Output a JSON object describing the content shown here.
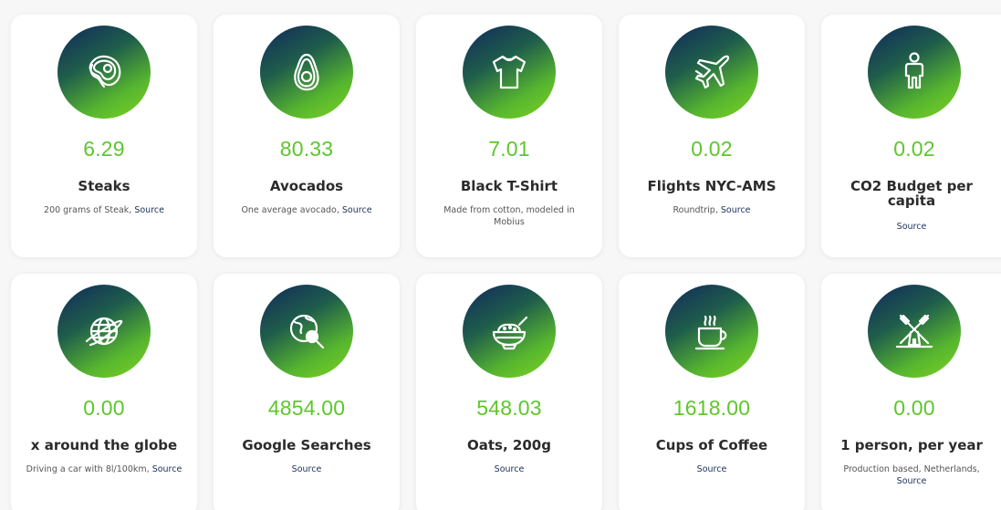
{
  "colors": {
    "accent_green": "#5ec62d",
    "icon_gradient_start": "#10285c",
    "icon_gradient_end": "#7ed321",
    "source_link": "#1c2f57"
  },
  "cards": [
    {
      "icon": "steak-icon",
      "value": "6.29",
      "title": "Steaks",
      "desc": "200 grams of Steak,",
      "source": "Source"
    },
    {
      "icon": "avocado-icon",
      "value": "80.33",
      "title": "Avocados",
      "desc": "One average avocado,",
      "source": "Source"
    },
    {
      "icon": "tshirt-icon",
      "value": "7.01",
      "title": "Black T-Shirt",
      "desc": "Made from cotton, modeled in Mobius",
      "source": ""
    },
    {
      "icon": "airplane-icon",
      "value": "0.02",
      "title": "Flights NYC-AMS",
      "desc": "Roundtrip,",
      "source": "Source"
    },
    {
      "icon": "person-icon",
      "value": "0.02",
      "title": "CO2 Budget per capita",
      "desc": "",
      "source": "Source"
    },
    {
      "icon": "globe-icon",
      "value": "0.00",
      "title": "x around the globe",
      "desc": "Driving a car with 8l/100km,",
      "source": "Source"
    },
    {
      "icon": "globe-search-icon",
      "value": "4854.00",
      "title": "Google Searches",
      "desc": "",
      "source": "Source"
    },
    {
      "icon": "bowl-icon",
      "value": "548.03",
      "title": "Oats, 200g",
      "desc": "",
      "source": "Source"
    },
    {
      "icon": "coffee-cup-icon",
      "value": "1618.00",
      "title": "Cups of Coffee",
      "desc": "",
      "source": "Source"
    },
    {
      "icon": "windmill-icon",
      "value": "0.00",
      "title": "1 person, per year",
      "desc": "Production based, Netherlands,",
      "source": "Source"
    }
  ]
}
